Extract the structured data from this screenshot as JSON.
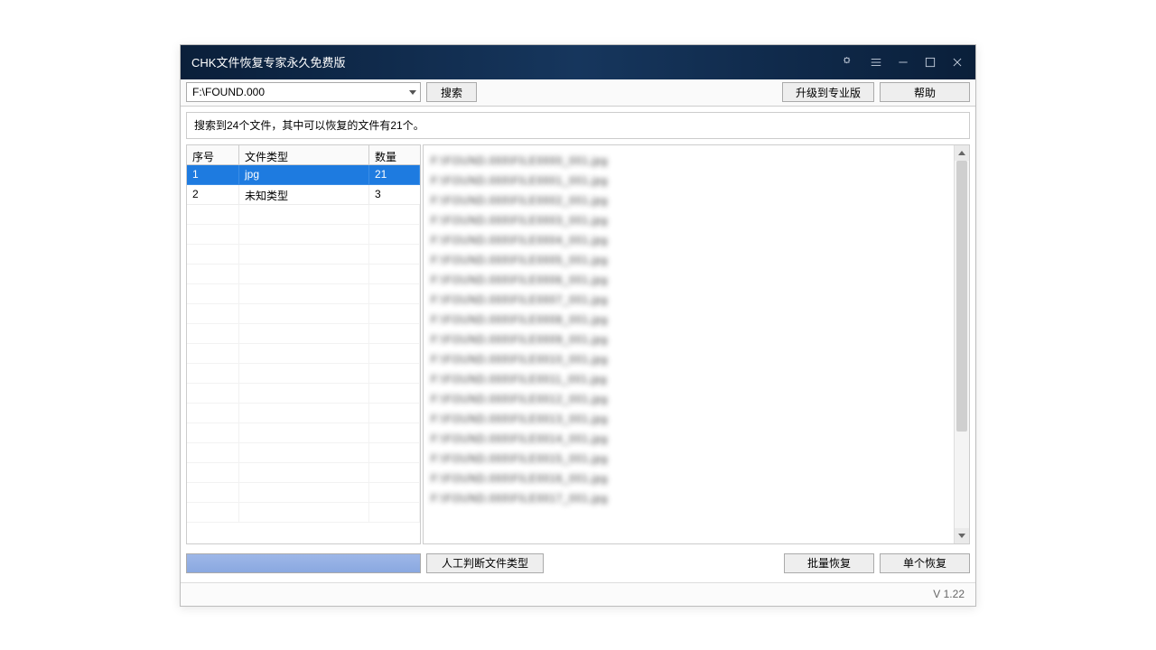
{
  "window": {
    "title": "CHK文件恢复专家永久免费版"
  },
  "toolbar": {
    "path": "F:\\FOUND.000",
    "search": "搜索",
    "upgrade": "升级到专业版",
    "help": "帮助"
  },
  "status": {
    "text": "搜索到24个文件，其中可以恢复的文件有21个。"
  },
  "columns": {
    "seq": "序号",
    "type": "文件类型",
    "count": "数量"
  },
  "rows": [
    {
      "seq": "1",
      "type": "jpg",
      "count": "21",
      "selected": true
    },
    {
      "seq": "2",
      "type": "未知类型",
      "count": "3",
      "selected": false
    }
  ],
  "files": [
    "F:\\FOUND.000\\FILE0000_001.jpg",
    "F:\\FOUND.000\\FILE0001_001.jpg",
    "F:\\FOUND.000\\FILE0002_001.jpg",
    "F:\\FOUND.000\\FILE0003_001.jpg",
    "F:\\FOUND.000\\FILE0004_001.jpg",
    "F:\\FOUND.000\\FILE0005_001.jpg",
    "F:\\FOUND.000\\FILE0006_001.jpg",
    "F:\\FOUND.000\\FILE0007_001.jpg",
    "F:\\FOUND.000\\FILE0008_001.jpg",
    "F:\\FOUND.000\\FILE0009_001.jpg",
    "F:\\FOUND.000\\FILE0010_001.jpg",
    "F:\\FOUND.000\\FILE0011_001.jpg",
    "F:\\FOUND.000\\FILE0012_001.jpg",
    "F:\\FOUND.000\\FILE0013_001.jpg",
    "F:\\FOUND.000\\FILE0014_001.jpg",
    "F:\\FOUND.000\\FILE0015_001.jpg",
    "F:\\FOUND.000\\FILE0016_001.jpg",
    "F:\\FOUND.000\\FILE0017_001.jpg"
  ],
  "bottom": {
    "judge": "人工判断文件类型",
    "batch": "批量恢复",
    "single": "单个恢复"
  },
  "footer": {
    "version": "V 1.22"
  }
}
